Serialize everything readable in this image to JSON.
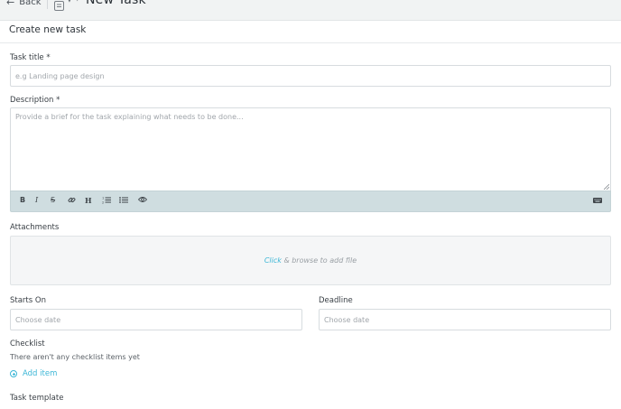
{
  "nav": {
    "back_label": "Back",
    "page_title": "New Task"
  },
  "form": {
    "header": "Create new task",
    "task_title": {
      "label": "Task title *",
      "placeholder": "e.g Landing page design"
    },
    "description": {
      "label": "Description *",
      "placeholder": "Provide a brief for the task explaining what needs to be done..."
    },
    "toolbar": {
      "bold": "B",
      "italic": "I",
      "strike": "S",
      "heading": "H"
    },
    "attachments": {
      "label": "Attachments",
      "click_text": "Click",
      "rest_text": " & browse to add file"
    },
    "starts_on": {
      "label": "Starts On",
      "placeholder": "Choose date"
    },
    "deadline": {
      "label": "Deadline",
      "placeholder": "Choose date"
    },
    "checklist": {
      "label": "Checklist",
      "empty_text": "There aren't any checklist items yet",
      "add_label": "Add item"
    },
    "template": {
      "label": "Task template"
    }
  },
  "colors": {
    "accent": "#3cb6d6",
    "toolbar_bg": "#cfdde0"
  }
}
